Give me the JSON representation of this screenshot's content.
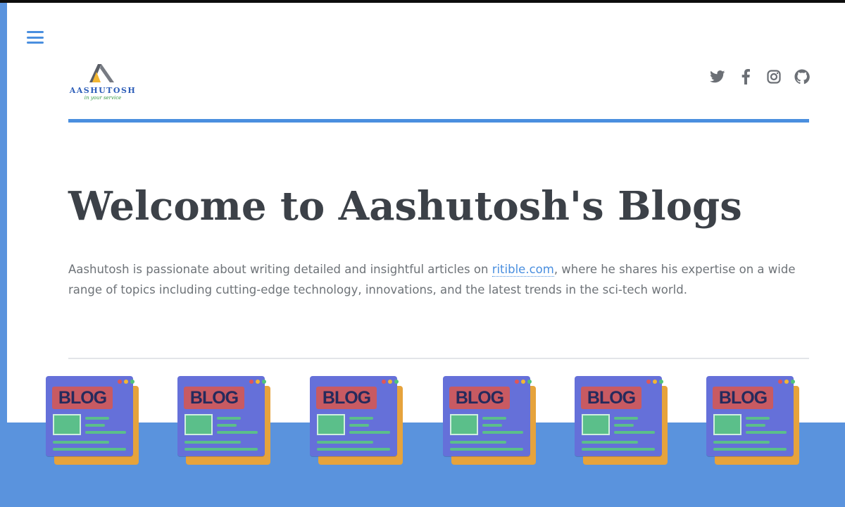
{
  "header": {
    "menu_icon": "hamburger-menu-icon",
    "logo": {
      "name": "AASHUTOSH",
      "tagline": "in your service"
    },
    "social": [
      {
        "name": "twitter",
        "icon": "twitter-icon"
      },
      {
        "name": "facebook",
        "icon": "facebook-icon"
      },
      {
        "name": "instagram",
        "icon": "instagram-icon"
      },
      {
        "name": "github",
        "icon": "github-icon"
      }
    ]
  },
  "main": {
    "title": "Welcome to Aashutosh's Blogs",
    "intro_before": "Aashutosh is passionate about writing detailed and insightful articles on ",
    "intro_link": "ritible.com",
    "intro_after": ", where he shares his expertise on a wide range of topics including cutting-edge technology, innovations, and the latest trends in the sci-tech world."
  },
  "blog_icons": [
    {
      "label": "BLOG"
    },
    {
      "label": "BLOG"
    },
    {
      "label": "BLOG"
    },
    {
      "label": "BLOG"
    },
    {
      "label": "BLOG"
    },
    {
      "label": "BLOG"
    }
  ],
  "colors": {
    "accent": "#4a8fdf",
    "background": "#5a93dd",
    "title": "#3c4148",
    "text": "#6e7378"
  }
}
